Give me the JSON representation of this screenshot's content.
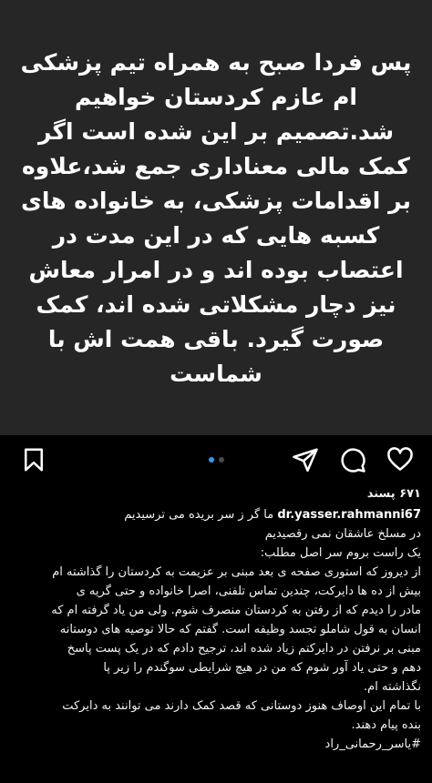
{
  "post": {
    "image_text": "پس فردا صبح به همراه تیم پزشکی ام عازم کردستان خواهیم شد.تصمیم بر این شده است اگر کمک مالی معناداری جمع شد،علاوه بر اقدامات پزشکی، به خانواده های کسبه هایی که در این مدت در اعتصاب بوده اند و در امرار معاش نیز دچار مشکلاتی شده اند، کمک صورت گیرد. باقی همت اش با شماست"
  },
  "actions": {
    "carousel_count": 2,
    "carousel_active": 1
  },
  "likes": "۶۷۱ پسند",
  "caption": {
    "username": "dr.yasser.rahmanni67",
    "first_line": " ما گر ز سر بریده می ترسیدیم",
    "lines": [
      "در مسلخ عاشقان نمی رقصیدیم",
      "یک راست بروم سر اصل مطلب:",
      "از دیروز که استوری صفحه ی بعد مبنی بر عزیمت به کردستان را گذاشته ام",
      "بیش از ده ها دایرکت، چندین تماس تلفنی، اصرا خانواده و حتی گریه ی",
      "مادر را دیدم که از رفتن به کردستان منصرف شوم. ولی من یاد گرفته ام که",
      "انسان به قول شاملو تجسد وظیفه است. گفتم که حالا توصیه های دوستانه",
      "مبنی بر نرفتن در دایرکتم زیاد شده اند، ترجیح دادم که در یک پست پاسخ",
      "دهم و حتی یاد آور شوم  که من در هیچ شرایطی سوگندم را زیر پا",
      "نگذاشته ام.",
      "با تمام این اوصاف هنوز دوستانی که قصد کمک دارند می توانند به دایرکت",
      "بنده پیام دهند.",
      "#یاسر_رحمانی_راد"
    ]
  }
}
